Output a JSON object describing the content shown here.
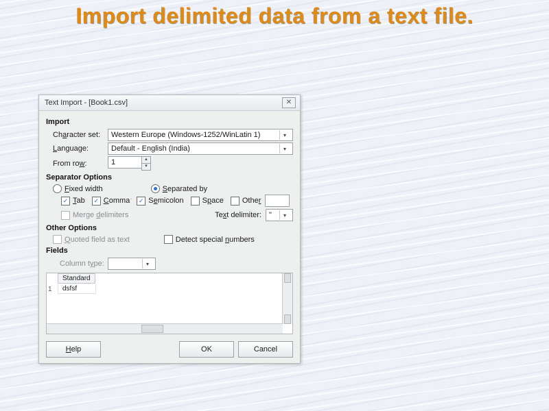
{
  "slide": {
    "title": "Import delimited data from a text file."
  },
  "dialog": {
    "title": "Text Import - [Book1.csv]",
    "sections": {
      "import": {
        "heading": "Import",
        "charset_label": "Character set:",
        "charset_value": "Western Europe (Windows-1252/WinLatin 1)",
        "language_label": "Language:",
        "language_value": "Default - English (India)",
        "from_row_label": "From row:",
        "from_row_value": "1"
      },
      "separator": {
        "heading": "Separator Options",
        "fixed_width": "Fixed width",
        "separated_by": "Separated by",
        "tab": "Tab",
        "comma": "Comma",
        "semicolon": "Semicolon",
        "space": "Space",
        "other": "Other",
        "other_value": "",
        "merge": "Merge delimiters",
        "text_delim_label": "Text delimiter:",
        "text_delim_value": "\""
      },
      "other": {
        "heading": "Other Options",
        "quoted": "Quoted field as text",
        "detect": "Detect special numbers"
      },
      "fields": {
        "heading": "Fields",
        "column_type_label": "Column type:",
        "column_type_value": "",
        "preview_header": "Standard",
        "preview_rownum": "1",
        "preview_cell": "dsfsf"
      }
    },
    "buttons": {
      "help": "Help",
      "ok": "OK",
      "cancel": "Cancel"
    }
  }
}
